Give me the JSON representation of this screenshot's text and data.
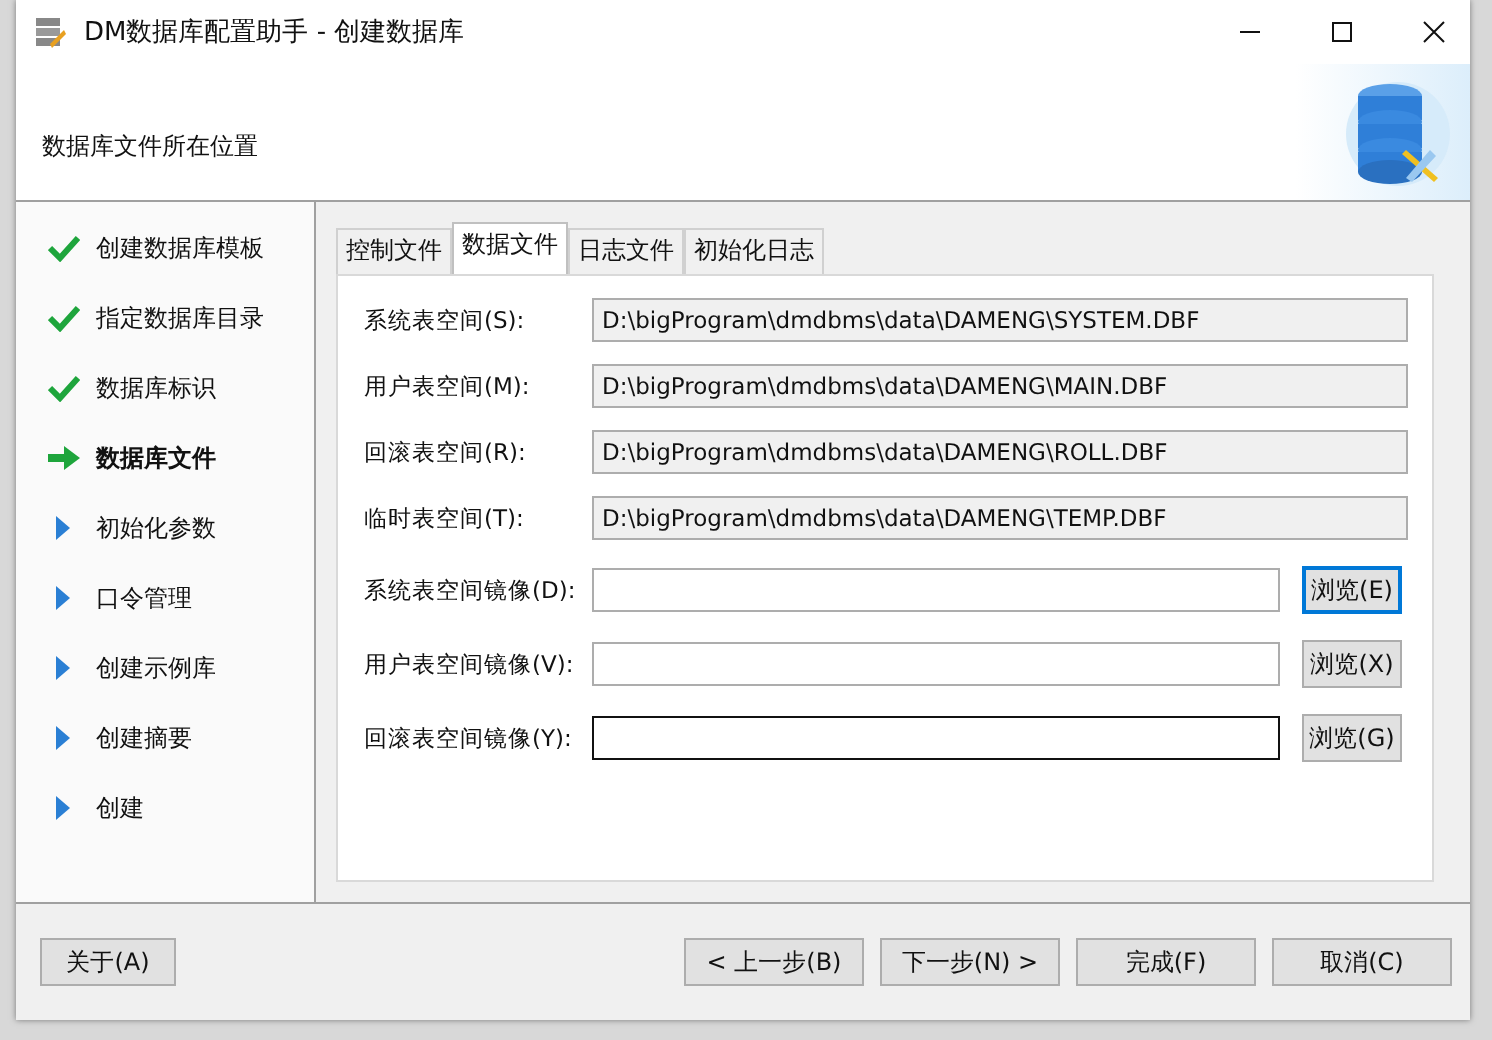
{
  "window": {
    "title": "DM数据库配置助手 - 创建数据库"
  },
  "header": {
    "description": "数据库文件所在位置"
  },
  "steps": [
    {
      "label": "创建数据库模板",
      "kind": "done"
    },
    {
      "label": "指定数据库目录",
      "kind": "done"
    },
    {
      "label": "数据库标识",
      "kind": "done"
    },
    {
      "label": "数据库文件",
      "kind": "current"
    },
    {
      "label": "初始化参数",
      "kind": "pending"
    },
    {
      "label": "口令管理",
      "kind": "pending"
    },
    {
      "label": "创建示例库",
      "kind": "pending"
    },
    {
      "label": "创建摘要",
      "kind": "pending"
    },
    {
      "label": "创建",
      "kind": "pending"
    }
  ],
  "tabs": [
    {
      "label": "控制文件",
      "selected": false
    },
    {
      "label": "数据文件",
      "selected": true
    },
    {
      "label": "日志文件",
      "selected": false
    },
    {
      "label": "初始化日志",
      "selected": false
    }
  ],
  "fields": [
    {
      "label": "系统表空间(S):",
      "value": "D:\\bigProgram\\dmdbms\\data\\DAMENG\\SYSTEM.DBF",
      "readonly": true,
      "focused": false
    },
    {
      "label": "用户表空间(M):",
      "value": "D:\\bigProgram\\dmdbms\\data\\DAMENG\\MAIN.DBF",
      "readonly": true,
      "focused": false
    },
    {
      "label": "回滚表空间(R):",
      "value": "D:\\bigProgram\\dmdbms\\data\\DAMENG\\ROLL.DBF",
      "readonly": true,
      "focused": false
    },
    {
      "label": "临时表空间(T):",
      "value": "D:\\bigProgram\\dmdbms\\data\\DAMENG\\TEMP.DBF",
      "readonly": true,
      "focused": false
    },
    {
      "label": "系统表空间镜像(D):",
      "readonly": false,
      "focused": false,
      "button": {
        "label": "浏览(E)",
        "focused": true
      }
    },
    {
      "label": "用户表空间镜像(V):",
      "readonly": false,
      "focused": false,
      "button": {
        "label": "浏览(X)",
        "focused": false
      }
    },
    {
      "label": "回滚表空间镜像(Y):",
      "readonly": false,
      "focused": true,
      "button": {
        "label": "浏览(G)",
        "focused": false
      }
    }
  ],
  "footer": {
    "left": [
      "关于(A)"
    ],
    "right": [
      "< 上一步(B)",
      "下一步(N) >",
      "完成(F)",
      "取消(C)"
    ]
  }
}
